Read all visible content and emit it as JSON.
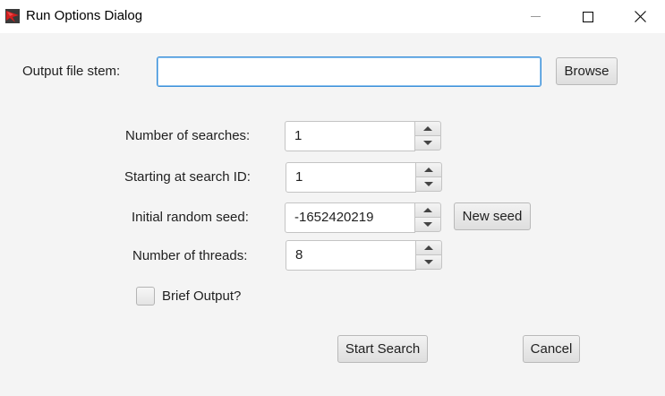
{
  "window": {
    "title": "Run Options Dialog",
    "icon": "red-flag-app-icon"
  },
  "output": {
    "label": "Output file stem:",
    "value": "",
    "browse_label": "Browse"
  },
  "fields": {
    "searches": {
      "label": "Number of searches:",
      "value": "1"
    },
    "start_id": {
      "label": "Starting at search ID:",
      "value": "1"
    },
    "seed": {
      "label": "Initial random seed:",
      "value": "-1652420219",
      "new_seed_label": "New seed"
    },
    "threads": {
      "label": "Number of threads:",
      "value": "8"
    }
  },
  "brief": {
    "label": "Brief Output?",
    "checked": false
  },
  "actions": {
    "start_label": "Start Search",
    "cancel_label": "Cancel"
  }
}
